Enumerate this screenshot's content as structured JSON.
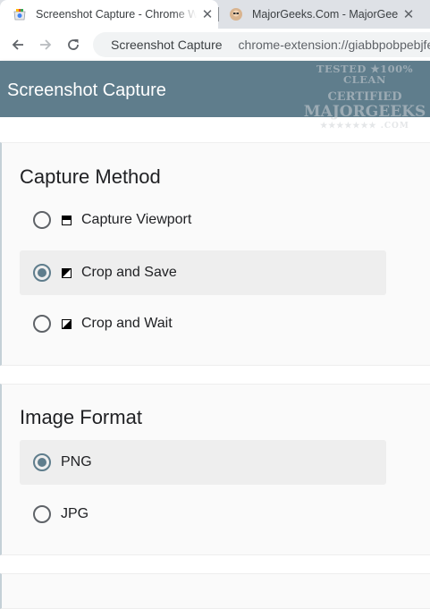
{
  "browser": {
    "tabs": [
      {
        "title": "Screenshot Capture - Chrome Web Store",
        "icon": "chrome-web-store-icon",
        "close": "✕"
      },
      {
        "title": "MajorGeeks.Com - MajorGeeks",
        "icon": "majorgeeks-icon",
        "close": "✕"
      }
    ],
    "omnibox": {
      "site": "Screenshot Capture",
      "url": "chrome-extension://giabbpobpebjfegnpcclkocepcgocklk/options/index.html"
    }
  },
  "header": {
    "title": "Screenshot Capture"
  },
  "watermark": {
    "line1": "TESTED ★100% CLEAN",
    "line2": "CERTIFIED",
    "line3": "MAJORGEEKS",
    "line4": "★★★★★★★ .COM"
  },
  "capture_method": {
    "title": "Capture Method",
    "options": [
      {
        "label": "Capture Viewport",
        "icon": "viewport-icon",
        "selected": false
      },
      {
        "label": "Crop and Save",
        "icon": "crop-save-icon",
        "selected": true
      },
      {
        "label": "Crop and Wait",
        "icon": "crop-wait-icon",
        "selected": false
      }
    ]
  },
  "image_format": {
    "title": "Image Format",
    "options": [
      {
        "label": "PNG",
        "selected": true
      },
      {
        "label": "JPG",
        "selected": false
      }
    ]
  },
  "colors": {
    "accent": "#5f7d8c",
    "selected_bg": "#eeeeee"
  }
}
